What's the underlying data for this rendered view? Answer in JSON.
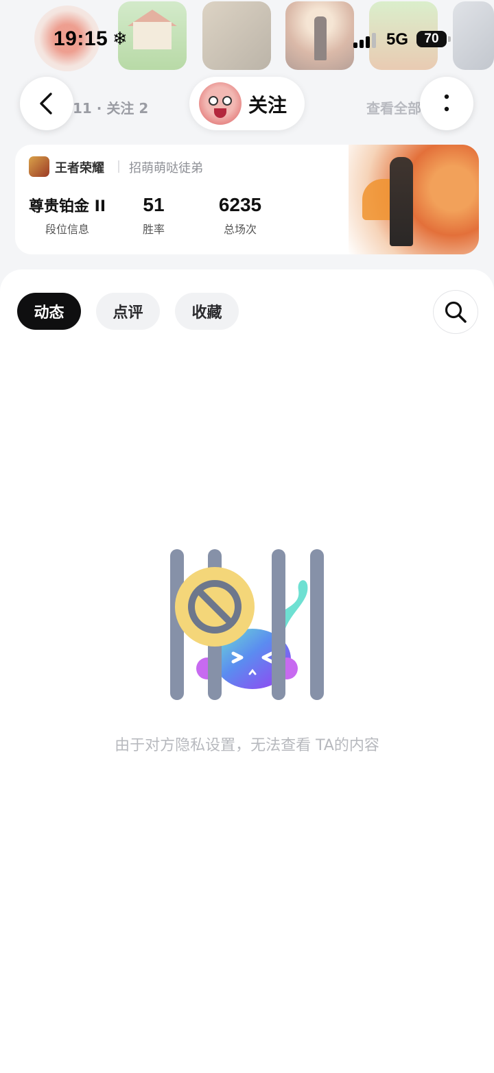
{
  "status_bar": {
    "time": "19:15",
    "extra_icon": "snowflake-icon",
    "network": "5G",
    "battery": "70"
  },
  "header": {
    "follow_stats": "11 · 关注 2",
    "follow_label": "关注",
    "see_all": "查看全部"
  },
  "game_card": {
    "game_name": "王者荣耀",
    "nickname": "招萌萌哒徒弟",
    "stats": [
      {
        "value": "尊贵铂金 II",
        "label": "段位信息"
      },
      {
        "value": "51",
        "label": "胜率"
      },
      {
        "value": "6235",
        "label": "总场次"
      }
    ]
  },
  "tabs": [
    {
      "label": "动态",
      "active": true
    },
    {
      "label": "点评",
      "active": false
    },
    {
      "label": "收藏",
      "active": false
    }
  ],
  "empty_state": {
    "message": "由于对方隐私设置，无法查看 TA的内容",
    "icon": "privacy-blocked-illustration"
  },
  "colors": {
    "tab_active_bg": "#0f0f10",
    "tab_idle_bg": "#f1f2f4",
    "muted_text": "#b7b9be",
    "bar_gray": "#8691a8",
    "ban_yellow": "#f4d679"
  }
}
